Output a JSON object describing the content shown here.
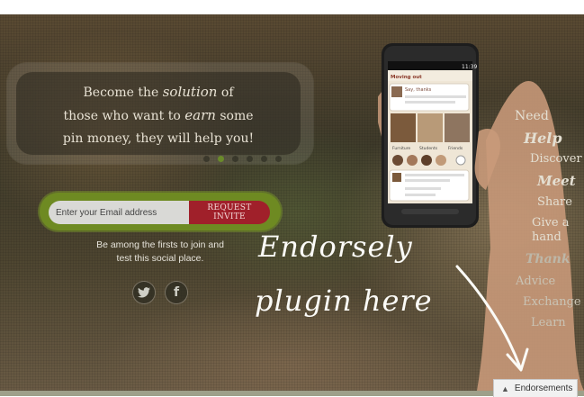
{
  "hero": {
    "quote": {
      "line1_pre": "Become the ",
      "line1_em": "solution",
      "line1_post": " of",
      "line2_pre": "those who want to ",
      "line2_em": "earn",
      "line2_post": " some",
      "line3": "pin money, they will help you!"
    },
    "slider": {
      "count": 6,
      "active_index": 1
    },
    "signup": {
      "email_placeholder": "Enter your Email address",
      "button_label": "REQUEST INVITE"
    },
    "join_line1": "Be among the firsts to join and",
    "join_line2": "test this social place.",
    "social": {
      "twitter_icon": "twitter-icon",
      "facebook_icon": "facebook-icon"
    }
  },
  "side_nav": {
    "items": [
      {
        "label": "Need"
      },
      {
        "label": "Help"
      },
      {
        "label": "Discover"
      },
      {
        "label": "Meet"
      },
      {
        "label": "Share"
      },
      {
        "label": "Give a"
      },
      {
        "label": "hand"
      },
      {
        "label": "Thank"
      },
      {
        "label": "Advice"
      },
      {
        "label": "Exchange"
      },
      {
        "label": "Learn"
      }
    ]
  },
  "annotation": {
    "line1": "Endorsely",
    "line2": "plugin here"
  },
  "phone_screen": {
    "status_time": "11:39",
    "card_title": "Moving out",
    "subcard_label": "Say, thanks",
    "categories": [
      "Furniture",
      "Students",
      "Friends"
    ]
  },
  "endorsements_tab": {
    "label": "Endorsements",
    "icon": "chevron-up-icon"
  },
  "colors": {
    "accent_green": "#6e8a22",
    "button_red": "#a0202a"
  }
}
